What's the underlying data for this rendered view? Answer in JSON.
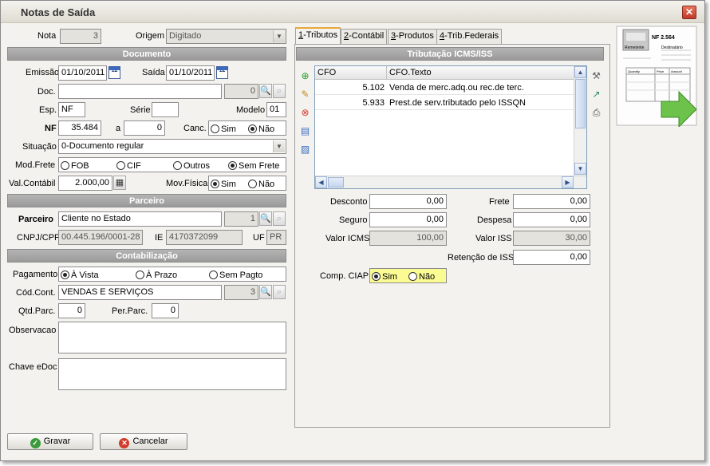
{
  "window": {
    "title": "Notas de Saída"
  },
  "form": {
    "nota_label": "Nota",
    "nota_value": "3",
    "origem_label": "Origem",
    "origem_value": "Digitado",
    "documento_header": "Documento",
    "emissao_label": "Emissão",
    "emissao_value": "01/10/2011",
    "saida_label": "Saída",
    "saida_value": "01/10/2011",
    "doc_label": "Doc.",
    "doc_value": "",
    "doc_code": "0",
    "esp_label": "Esp.",
    "esp_value": "NF",
    "serie_label": "Série",
    "serie_value": "",
    "modelo_label": "Modelo",
    "modelo_value": "01",
    "nf_label": "NF",
    "nf_value": "35.484",
    "a_label": "a",
    "a_value": "0",
    "canc_label": "Canc.",
    "canc_sim": "Sim",
    "canc_nao": "Não",
    "situacao_label": "Situação",
    "situacao_value": "0-Documento regular",
    "modfrete_label": "Mod.Frete",
    "modfrete_fob": "FOB",
    "modfrete_cif": "CIF",
    "modfrete_outros": "Outros",
    "modfrete_sem": "Sem Frete",
    "valcontabil_label": "Val.Contábil",
    "valcontabil_value": "2.000,00",
    "movfisica_label": "Mov.Física",
    "movfisica_sim": "Sim",
    "movfisica_nao": "Não",
    "parceiro_header": "Parceiro",
    "parceiro_label": "Parceiro",
    "parceiro_value": "Cliente no Estado",
    "parceiro_code": "1",
    "cnpj_label": "CNPJ/CPF",
    "cnpj_value": "00.445.196/0001-28",
    "ie_label": "IE",
    "ie_value": "4170372099",
    "uf_label": "UF",
    "uf_value": "PR",
    "contab_header": "Contabilização",
    "pagamento_label": "Pagamento",
    "pag_vista": "À Vista",
    "pag_prazo": "À Prazo",
    "pag_sem": "Sem Pagto",
    "codcont_label": "Cód.Cont.",
    "codcont_value": "VENDAS E SERVIÇOS",
    "codcont_code": "3",
    "qtdparc_label": "Qtd.Parc.",
    "qtdparc_value": "0",
    "perparc_label": "Per.Parc.",
    "perparc_value": "0",
    "observacao_label": "Observacao",
    "chave_label": "Chave eDoc"
  },
  "tabs": [
    {
      "num": "1",
      "label": "-Tributos"
    },
    {
      "num": "2",
      "label": "-Contábil"
    },
    {
      "num": "3",
      "label": "-Produtos"
    },
    {
      "num": "4",
      "label": "-Trib.Federais"
    }
  ],
  "tributos": {
    "header": "Tributação ICMS/ISS",
    "col_cfo": "CFO",
    "col_texto": "CFO.Texto",
    "rows": [
      {
        "cfo": "5.102",
        "texto": "Venda de merc.adq.ou rec.de terc."
      },
      {
        "cfo": "5.933",
        "texto": "Prest.de serv.tributado pelo ISSQN"
      }
    ],
    "desconto_label": "Desconto",
    "desconto_value": "0,00",
    "frete_label": "Frete",
    "frete_value": "0,00",
    "seguro_label": "Seguro",
    "seguro_value": "0,00",
    "despesa_label": "Despesa",
    "despesa_value": "0,00",
    "valoricms_label": "Valor ICMS",
    "valoricms_value": "100,00",
    "valoriss_label": "Valor ISS",
    "valoriss_value": "30,00",
    "retencao_label": "Retenção de ISS",
    "retencao_value": "0,00",
    "ciap_label": "Comp. CIAP",
    "ciap_sim": "Sim",
    "ciap_nao": "Não"
  },
  "nf_image": {
    "title": "NF 2.564",
    "remetente": "Remetente",
    "destinatario": "Destinatário",
    "quantity": "Quantity",
    "price": "Price",
    "amount": "Amount"
  },
  "footer": {
    "gravar": "Gravar",
    "cancelar": "Cancelar"
  }
}
